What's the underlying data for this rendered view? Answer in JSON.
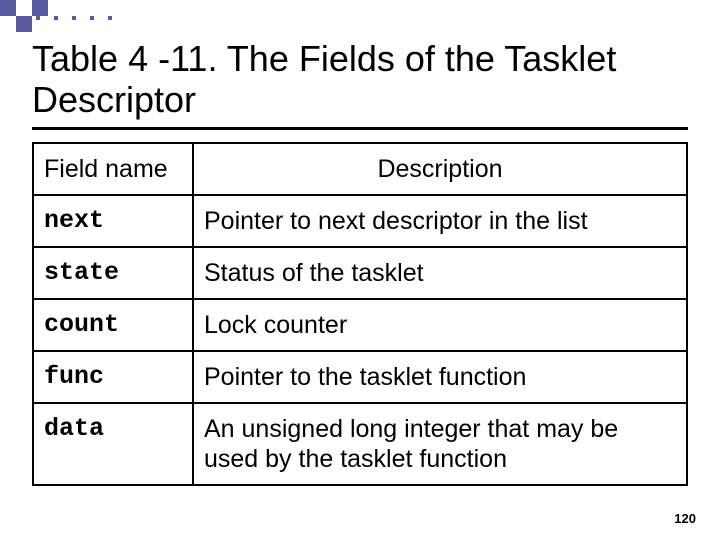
{
  "title": "Table 4 -11. The Fields of the Tasklet Descriptor",
  "columns": {
    "name": "Field name",
    "desc": "Description"
  },
  "rows": [
    {
      "name": "next",
      "desc": "Pointer to next descriptor in the list"
    },
    {
      "name": "state",
      "desc": "Status of the tasklet"
    },
    {
      "name": "count",
      "desc": "Lock counter"
    },
    {
      "name": "func",
      "desc": "Pointer to the tasklet function"
    },
    {
      "name": "data",
      "desc": "An unsigned long integer that may be used by the tasklet function"
    }
  ],
  "page_number": "120"
}
